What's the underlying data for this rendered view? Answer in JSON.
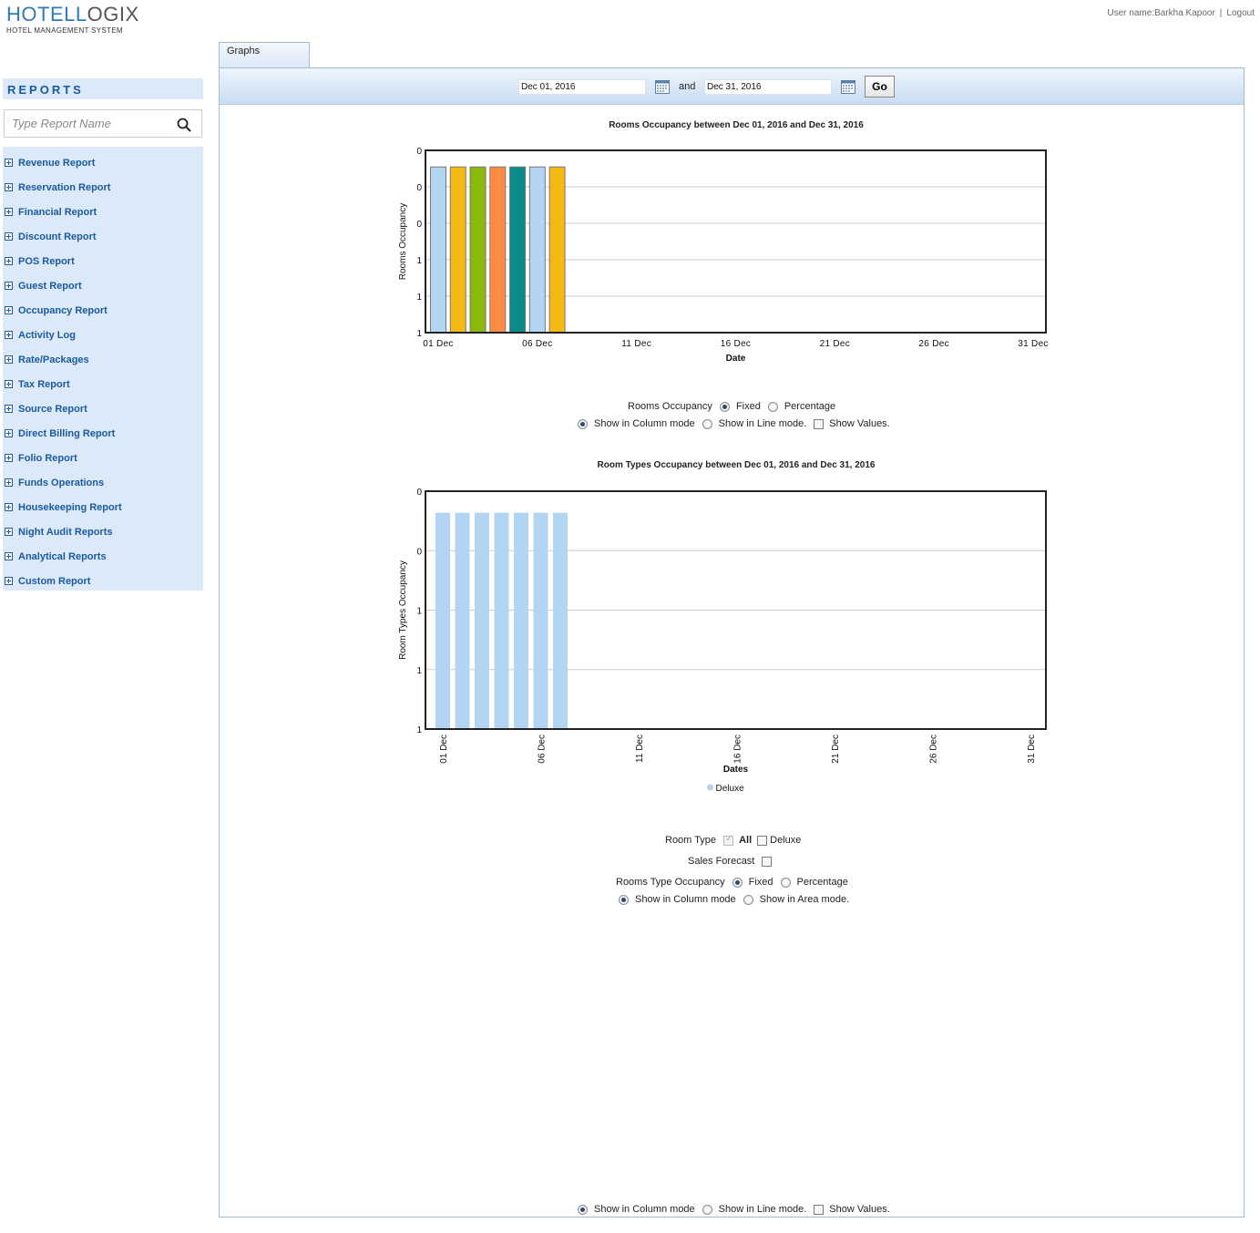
{
  "brand": {
    "name_part1": "HOTEL",
    "name_part2": "OGIX",
    "name_l": "L",
    "subtitle": "HOTEL MANAGEMENT SYSTEM"
  },
  "userbar": {
    "user_label": "User name:Barkha Kapoor",
    "separator": "|",
    "logout": "Logout"
  },
  "sidebar": {
    "title": "REPORTS",
    "search_placeholder": "Type Report Name",
    "items": [
      {
        "label": "Revenue Report"
      },
      {
        "label": "Reservation Report"
      },
      {
        "label": "Financial Report"
      },
      {
        "label": "Discount Report"
      },
      {
        "label": "POS Report"
      },
      {
        "label": "Guest Report"
      },
      {
        "label": "Occupancy Report"
      },
      {
        "label": "Activity Log"
      },
      {
        "label": "Rate/Packages"
      },
      {
        "label": "Tax Report"
      },
      {
        "label": "Source Report"
      },
      {
        "label": "Direct Billing Report"
      },
      {
        "label": "Folio Report"
      },
      {
        "label": "Funds Operations"
      },
      {
        "label": "Housekeeping Report"
      },
      {
        "label": "Night Audit Reports"
      },
      {
        "label": "Analytical Reports"
      },
      {
        "label": "Custom Report"
      }
    ]
  },
  "tab": {
    "label": "Graphs"
  },
  "toolbar": {
    "from_date": "Dec 01, 2016",
    "and_label": "and",
    "to_date": "Dec 31, 2016",
    "go_label": "Go"
  },
  "colors": {
    "accent": "#1a5aa0",
    "sidebar_bg": "#dce9f8",
    "bar_palette": [
      "#b3d5f4",
      "#f5b914",
      "#8cb70b",
      "#ff8c42",
      "#0b8b89",
      "#b3d5f4",
      "#f5b914"
    ]
  },
  "chart1": {
    "title": "Rooms Occupancy between Dec 01, 2016 and Dec 31, 2016",
    "controls": {
      "metric_label": "Rooms Occupancy",
      "fixed_label": "Fixed",
      "percentage_label": "Percentage",
      "column_label": "Show in Column mode",
      "line_label": "Show in Line mode.",
      "values_label": "Show Values."
    }
  },
  "chart2": {
    "title": "Room Types Occupancy  between Dec 01, 2016 and Dec 31, 2016",
    "controls": {
      "room_type_label": "Room Type",
      "all_label": "All",
      "deluxe_label": "Deluxe",
      "sales_forecast_label": "Sales Forecast",
      "metric_label": "Rooms Type Occupancy",
      "fixed_label": "Fixed",
      "percentage_label": "Percentage",
      "column_label": "Show in Column mode",
      "area_label": "Show in Area mode."
    }
  },
  "bottom_controls": {
    "column_label": "Show in Column mode",
    "line_label": "Show in Line mode.",
    "values_label": "Show Values."
  },
  "chart_data": [
    {
      "type": "bar",
      "title": "Rooms Occupancy between Dec 01, 2016 and Dec 31, 2016",
      "xlabel": "Date",
      "ylabel": "Rooms Occupancy",
      "x_tick_labels": [
        "01 Dec",
        "06 Dec",
        "11 Dec",
        "16 Dec",
        "21 Dec",
        "26 Dec",
        "31 Dec"
      ],
      "y_tick_labels": [
        "1",
        "1",
        "1",
        "0",
        "0",
        "0"
      ],
      "categories": [
        "01 Dec",
        "02 Dec",
        "03 Dec",
        "04 Dec",
        "05 Dec",
        "06 Dec",
        "07 Dec"
      ],
      "values": [
        1,
        1,
        1,
        1,
        1,
        1,
        1
      ],
      "ylim": [
        0,
        1.1
      ],
      "x_range_days": [
        1,
        31
      ],
      "grid": true,
      "legend": "none"
    },
    {
      "type": "bar",
      "title": "Room Types Occupancy  between Dec 01, 2016 and Dec 31, 2016",
      "xlabel": "Dates",
      "ylabel": "Room Types Occupancy",
      "x_tick_labels": [
        "01 Dec",
        "06 Dec",
        "11 Dec",
        "16 Dec",
        "21 Dec",
        "26 Dec",
        "31 Dec"
      ],
      "y_tick_labels": [
        "1",
        "1",
        "1",
        "0",
        "0"
      ],
      "categories": [
        "01 Dec",
        "02 Dec",
        "03 Dec",
        "04 Dec",
        "05 Dec",
        "06 Dec",
        "07 Dec"
      ],
      "series": [
        {
          "name": "Deluxe",
          "values": [
            1,
            1,
            1,
            1,
            1,
            1,
            1
          ],
          "color": "#b3d5f4"
        }
      ],
      "ylim": [
        0,
        1.1
      ],
      "x_range_days": [
        1,
        31
      ],
      "grid": true,
      "legend": "bottom-center"
    }
  ]
}
